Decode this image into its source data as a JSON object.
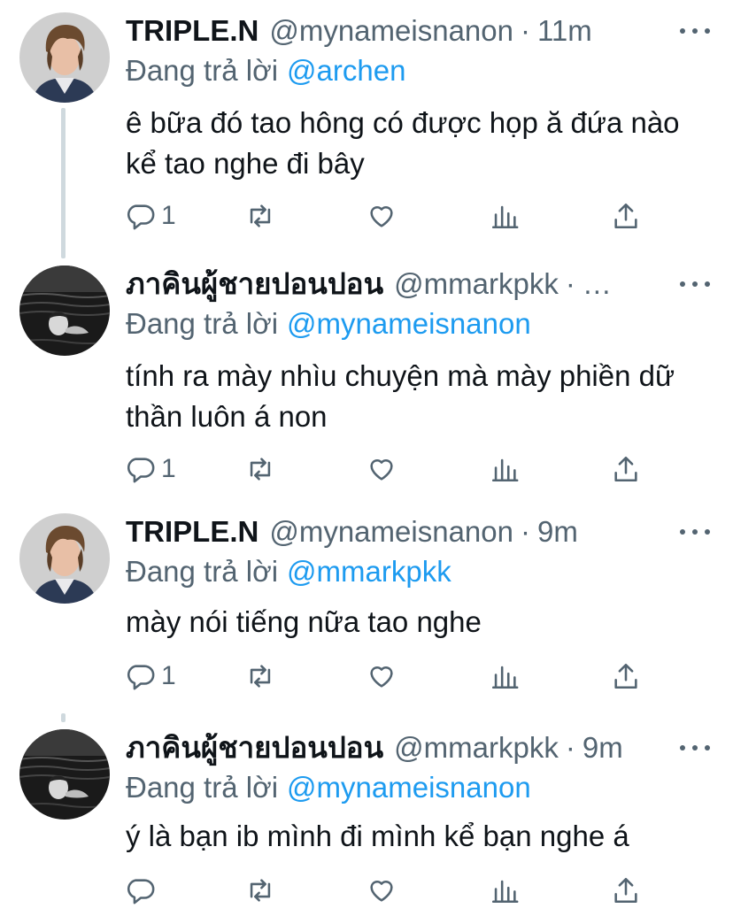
{
  "tweets": [
    {
      "display_name": "TRIPLE.N",
      "handle": "@mynameisnanon",
      "time": "11m",
      "replying_label": "Đang trả lời",
      "replying_to": "@archen",
      "text": "ê bữa đó tao hông có được họp ă đứa nào kể tao nghe đi bây",
      "reply_count": "1",
      "avatar": "portrait-young-man-icon"
    },
    {
      "display_name": "ภาคินผู้ชายปอนปอน",
      "handle": "@mmarkpkk",
      "time": "…",
      "replying_label": "Đang trả lời",
      "replying_to": "@mynameisnanon",
      "text": "tính ra mày nhìu chuyện mà mày phiền dữ thần luôn á non",
      "reply_count": "1",
      "avatar": "monochrome-sea-portrait-icon"
    },
    {
      "display_name": "TRIPLE.N",
      "handle": "@mynameisnanon",
      "time": "9m",
      "replying_label": "Đang trả lời",
      "replying_to": "@mmarkpkk",
      "text": "mày nói tiếng nữa tao nghe",
      "reply_count": "1",
      "avatar": "portrait-young-man-icon"
    },
    {
      "display_name": "ภาคินผู้ชายปอนปอน",
      "handle": "@mmarkpkk",
      "time": "9m",
      "replying_label": "Đang trả lời",
      "replying_to": "@mynameisnanon",
      "text": "ý là bạn ib mình đi mình kể bạn nghe á",
      "reply_count": "",
      "avatar": "monochrome-sea-portrait-icon"
    }
  ],
  "separator": "·",
  "colors": {
    "text": "#0f1419",
    "secondary": "#536471",
    "link": "#1d9bf0",
    "thread_line": "#cfd9de"
  }
}
